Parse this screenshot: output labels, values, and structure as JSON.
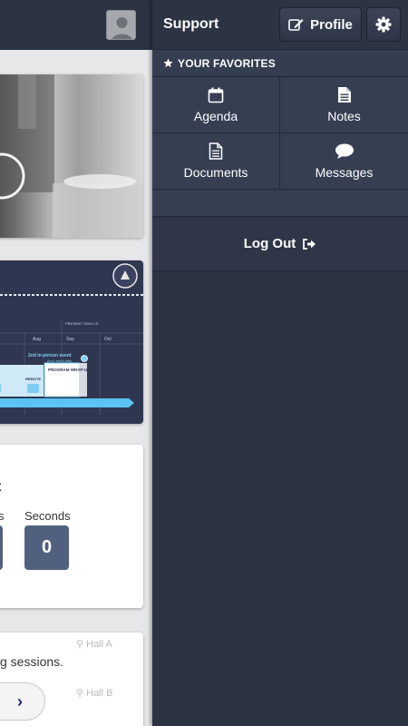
{
  "menu": {
    "title": "Support",
    "profile_label": "Profile",
    "favorites_header": "YOUR FAVORITES",
    "favorites": [
      {
        "label": "Agenda",
        "icon": "calendar-icon"
      },
      {
        "label": "Notes",
        "icon": "notes-icon"
      },
      {
        "label": "Documents",
        "icon": "document-icon"
      },
      {
        "label": "Messages",
        "icon": "chat-bubble-icon"
      }
    ],
    "logout_label": "Log Out"
  },
  "background": {
    "countdown": {
      "seconds_label": "Seconds",
      "seconds_value": "0",
      "colon": ":",
      "partial_label": "s"
    },
    "timeline": {
      "month_aug": "Aug",
      "month_sep": "Sep",
      "month_oct": "Oct",
      "event_title": "2nd in-person event",
      "event_sub": "(incl. trend talk)",
      "remote": "REMOTE",
      "wrapup": "PROGRAM WRAP-UP",
      "present": "PRESENT OWN CS"
    },
    "sessions": {
      "text": "g sessions.",
      "hall_a": "Hall A",
      "hall_b": "Hall B"
    }
  },
  "colors": {
    "menu_bg": "#2b3242",
    "cell_bg": "#363e52",
    "countdown_box": "#52607f"
  }
}
